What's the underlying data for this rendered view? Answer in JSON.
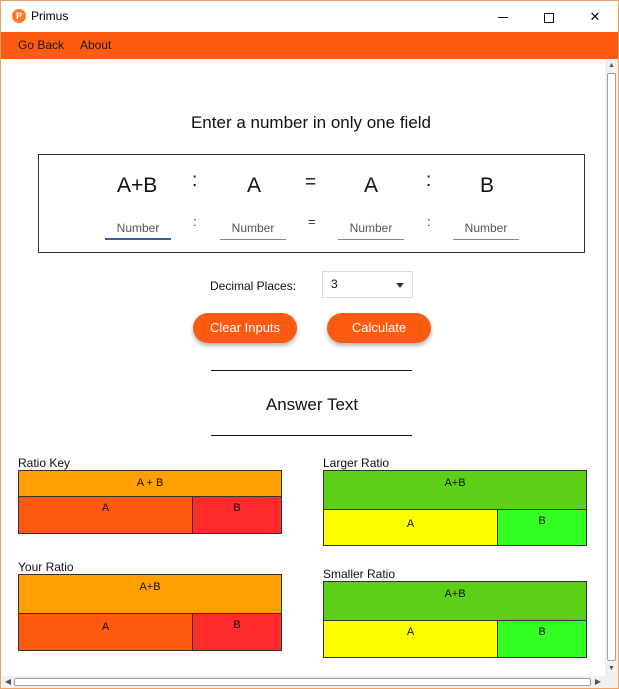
{
  "window": {
    "title": "Primus",
    "icon_letter": "P",
    "accent_color": "#ff5a12"
  },
  "titlebar_icons": {
    "minimize": "minimize-icon",
    "maximize": "maximize-icon",
    "close_glyph": "✕"
  },
  "menu": {
    "go_back": "Go Back",
    "about": "About"
  },
  "instruction": "Enter a number in only one field",
  "ratio": {
    "labels": [
      "A+B",
      "A",
      "A",
      "B"
    ],
    "colon": ":",
    "equals": "=",
    "small_colon": ":",
    "small_equals": "=",
    "input_placeholder": "Number"
  },
  "decimal": {
    "label": "Decimal Places:",
    "value": "3"
  },
  "buttons": {
    "clear": "Clear Inputs",
    "calculate": "Calculate"
  },
  "answer_text": "Answer Text",
  "diagrams": {
    "ratio_key": {
      "title": "Ratio Key",
      "top": "A + B",
      "left": "A",
      "right": "B"
    },
    "your_ratio": {
      "title": "Your Ratio",
      "top": "A+B",
      "left": "A",
      "right": "B"
    },
    "larger_ratio": {
      "title": "Larger Ratio",
      "top": "A+B",
      "left": "A",
      "right": "B"
    },
    "smaller_ratio": {
      "title": "Smaller Ratio",
      "top": "A+B",
      "left": "A",
      "right": "B"
    }
  },
  "colors": {
    "orange_top": "#ffa000",
    "orange_a": "#ff5a12",
    "red_b": "#ff2a2a",
    "green_top": "#5bd016",
    "yellow_a": "#ffff00",
    "green_b": "#33ff22"
  }
}
